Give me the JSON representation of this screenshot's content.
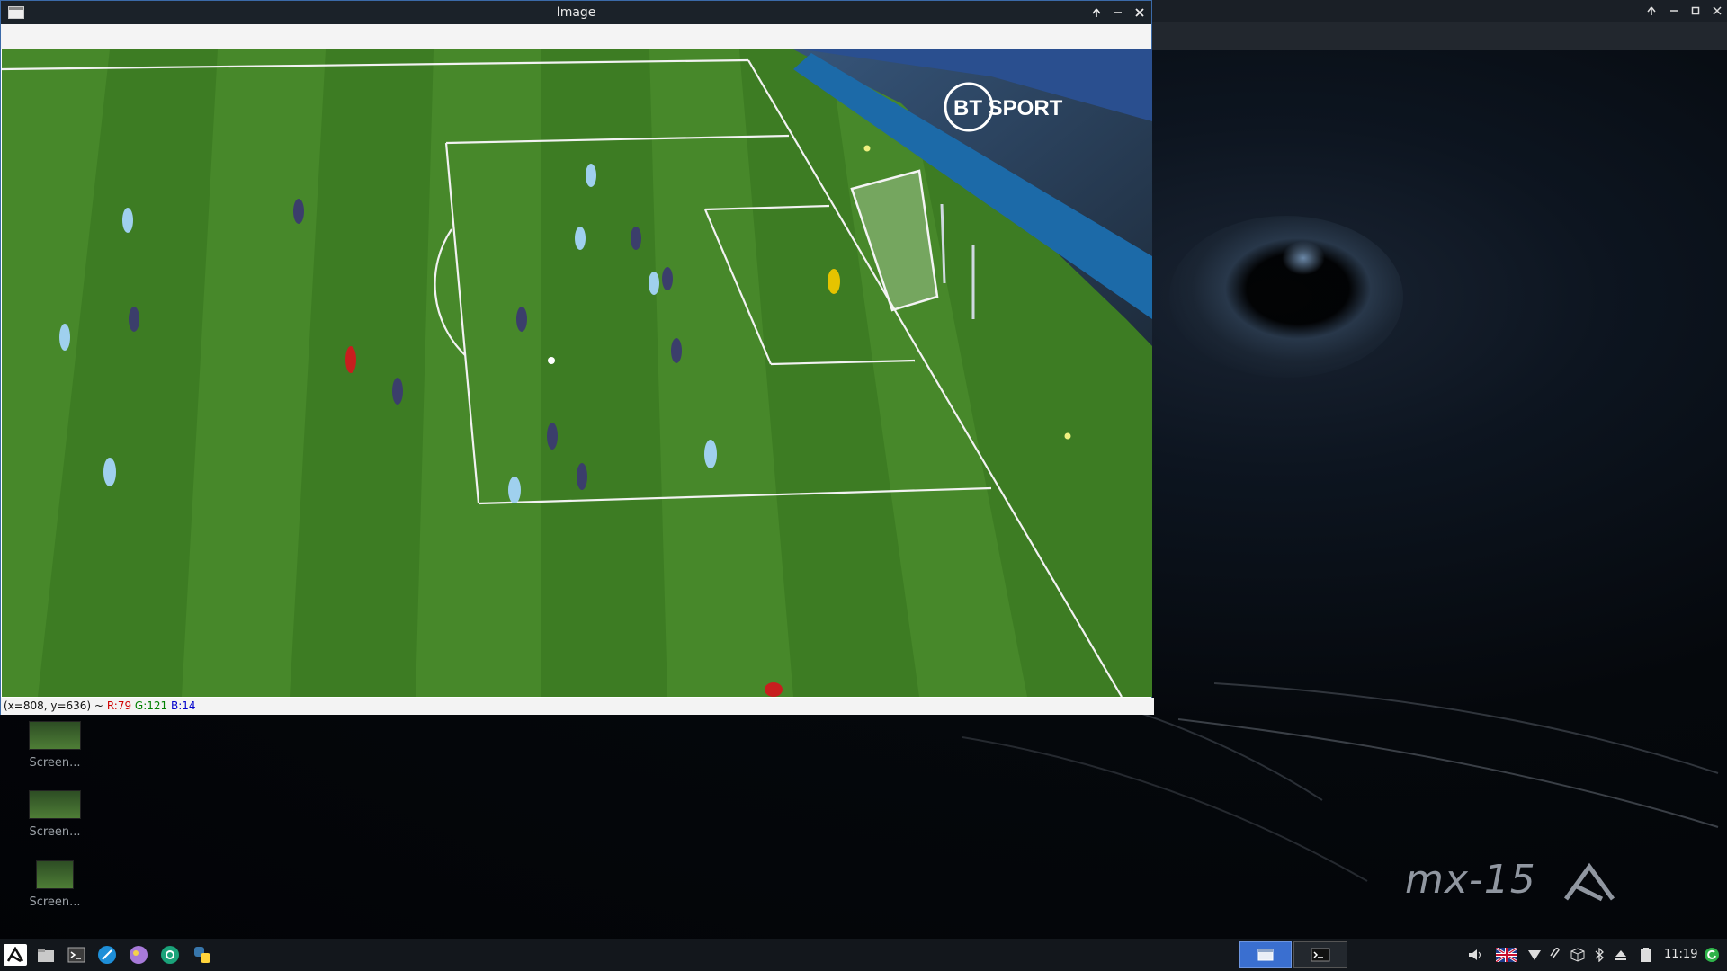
{
  "window": {
    "title": "Image",
    "status": {
      "coords": "(x=808, y=636) ~",
      "r": "R:79",
      "g": "G:121",
      "b": "B:14"
    }
  },
  "image": {
    "broadcaster_logo": "BT SPORT"
  },
  "desktop": {
    "icons": [
      {
        "label": "Screen..."
      },
      {
        "label": "Screen..."
      },
      {
        "label": "Screen..."
      }
    ],
    "branding": "mx-15"
  },
  "taskbar": {
    "launchers": [
      "mx-logo-icon",
      "file-manager-icon",
      "terminal-icon",
      "browser-icon",
      "paint-icon",
      "settings-icon",
      "python-icon"
    ],
    "clock": "11:19"
  },
  "colors": {
    "titlebar": "#1b2229",
    "taskbar": "#13171c",
    "pitch_green": "#3c7a22",
    "active_task": "#3a6fd0"
  }
}
